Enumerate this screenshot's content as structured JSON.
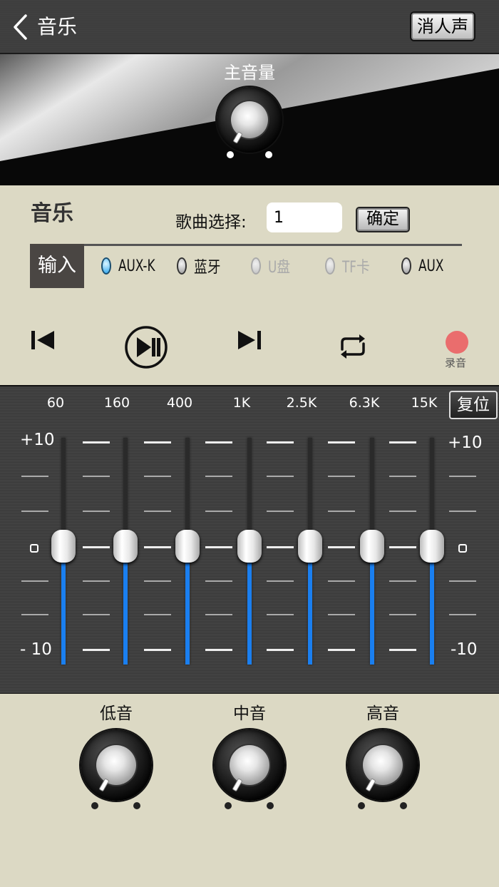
{
  "header": {
    "title": "音乐",
    "vocal_cut_label": "消人声"
  },
  "master": {
    "title": "主音量",
    "knob_level": 0.0
  },
  "music": {
    "section_title": "音乐",
    "song_select_label": "歌曲选择:",
    "song_number": "1",
    "confirm_label": "确定",
    "input_label": "输入",
    "sources": [
      {
        "label": "AUX-K",
        "selected": true,
        "enabled": true
      },
      {
        "label": "蓝牙",
        "selected": false,
        "enabled": true
      },
      {
        "label": "U盘",
        "selected": false,
        "enabled": false
      },
      {
        "label": "TF卡",
        "selected": false,
        "enabled": false
      },
      {
        "label": "AUX",
        "selected": false,
        "enabled": true
      }
    ],
    "transport": {
      "prev_icon": "skip-previous-icon",
      "play_pause_icon": "play-pause-icon",
      "next_icon": "skip-next-icon",
      "repeat_icon": "repeat-icon",
      "record_icon": "record-icon",
      "record_label": "录音",
      "record_color": "#ea6d6d"
    }
  },
  "equalizer": {
    "reset_label": "复位",
    "scale_top": "+10",
    "scale_bottom": "- 10",
    "scale_top_right": "+10",
    "scale_bottom_right": "-10",
    "range": [
      -10,
      10
    ],
    "accent": "#1a7ff0",
    "bands": [
      {
        "freq": "60",
        "value": 0
      },
      {
        "freq": "160",
        "value": 0
      },
      {
        "freq": "400",
        "value": 0
      },
      {
        "freq": "1K",
        "value": 0
      },
      {
        "freq": "2.5K",
        "value": 0
      },
      {
        "freq": "6.3K",
        "value": 0
      },
      {
        "freq": "15K",
        "value": 0
      }
    ]
  },
  "tone": {
    "bass_label": "低音",
    "mid_label": "中音",
    "treble_label": "高音"
  }
}
